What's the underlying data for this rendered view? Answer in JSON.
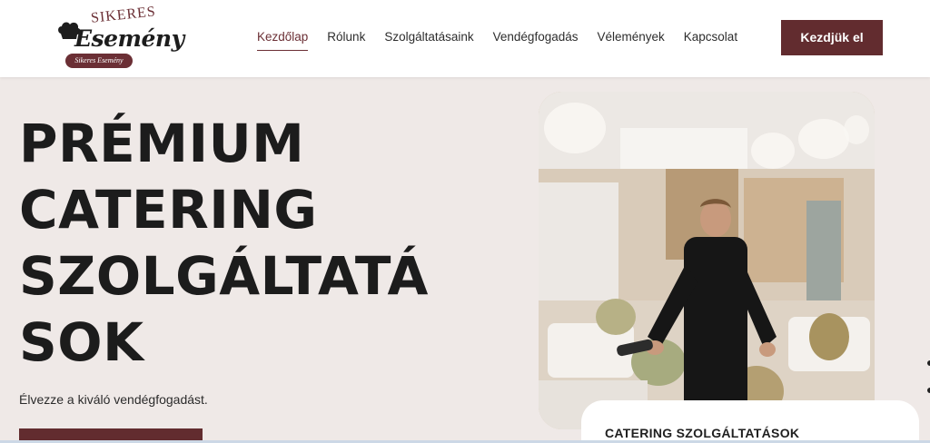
{
  "header": {
    "logo": {
      "top_text": "SIKERES",
      "main_text": "Esemény",
      "ribbon_text": "Sikeres Esemény",
      "icon": "chef-hat-icon"
    },
    "nav": [
      {
        "label": "Kezdőlap",
        "active": true
      },
      {
        "label": "Rólunk",
        "active": false
      },
      {
        "label": "Szolgáltatásaink",
        "active": false
      },
      {
        "label": "Vendégfogadás",
        "active": false
      },
      {
        "label": "Vélemények",
        "active": false
      },
      {
        "label": "Kapcsolat",
        "active": false
      }
    ],
    "cta_label": "Kezdjük el"
  },
  "hero": {
    "title_lines": [
      "PRÉMIUM",
      "CATERING",
      "SZOLGÁLTATÁ",
      "SOK"
    ],
    "subtitle": "Élvezze a kiváló vendégfogadást."
  },
  "card": {
    "title": "CATERING SZOLGÁLTATÁSOK"
  },
  "colors": {
    "brand": "#622c2f",
    "background": "#efe9e7",
    "header_bg": "#ffffff"
  }
}
